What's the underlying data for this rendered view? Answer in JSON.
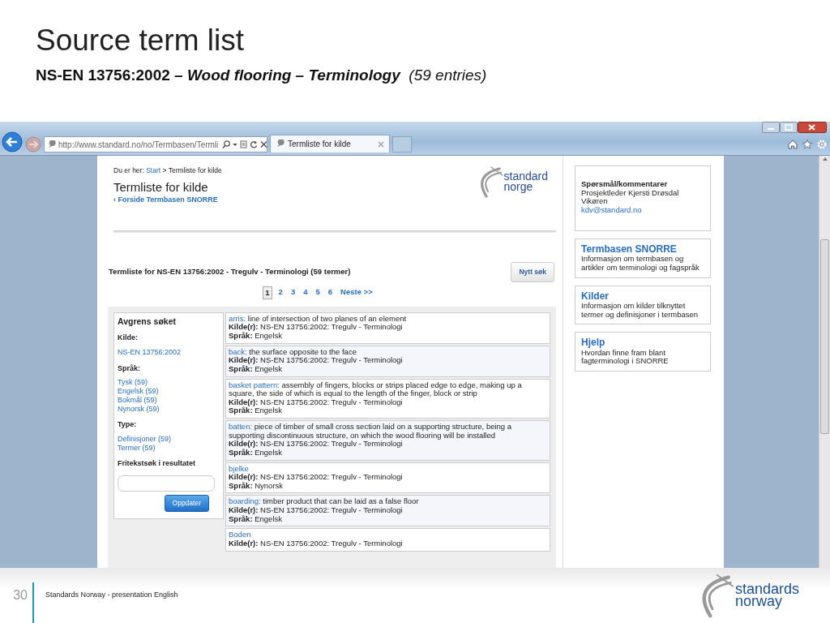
{
  "slide": {
    "title": "Source term list",
    "subtitle": {
      "code": "NS-EN 13756:2002 –",
      "name": "Wood flooring – Terminology",
      "count": "(59 entries)"
    }
  },
  "browser": {
    "address": "http://www.standard.no/no/Termbasen/Termli",
    "tabs": [
      {
        "label": "Termliste for kilde",
        "selected": true
      }
    ]
  },
  "page": {
    "breadcrumb": {
      "label": "Du er her:",
      "items": [
        "Start",
        "Termliste for kilde"
      ],
      "separator": ">"
    },
    "heading": "Termliste for kilde",
    "back_link": "‹ Forside Termbasen SNORRE",
    "logo": [
      "standard",
      "norge"
    ],
    "list_title": "Termliste for NS-EN 13756:2002 - Tregulv - Terminologi (59 termer)",
    "new_search_button": "Nytt søk",
    "pagination": [
      {
        "label": "1",
        "selected": true
      },
      {
        "label": "2",
        "selected": false
      },
      {
        "label": "3",
        "selected": false
      },
      {
        "label": "4",
        "selected": false
      },
      {
        "label": "5",
        "selected": false
      },
      {
        "label": "6",
        "selected": false
      },
      {
        "label": "Neste >>",
        "selected": false
      }
    ],
    "filter": {
      "title": "Avgrens søket",
      "sections": [
        {
          "heading": "Kilde:",
          "links": [
            "NS-EN 13756:2002"
          ]
        },
        {
          "heading": "Språk:",
          "links": [
            "Tysk (59)",
            "Engelsk (59)",
            "Bokmål (59)",
            "Nynorsk (59)"
          ]
        },
        {
          "heading": "Type:",
          "links": [
            "Definisjoner (59)",
            "Termer (59)"
          ]
        }
      ],
      "search_label": "Fritekstsøk i resultatet",
      "button": "Oppdater"
    },
    "entries": [
      {
        "term": "arris:",
        "definition": "line of intersection of two planes of an element",
        "source_label": "Kilde(r):",
        "source": "NS-EN 13756:2002: Tregulv - Terminologi",
        "language_label": "Språk:",
        "language": "Engelsk"
      },
      {
        "term": "back:",
        "definition": "the surface opposite to the face",
        "source_label": "Kilde(r):",
        "source": "NS-EN 13756:2002: Tregulv - Terminologi",
        "language_label": "Språk:",
        "language": "Engelsk"
      },
      {
        "term": "basket pattern:",
        "definition": "assembly of fingers, blocks or strips placed edge to edge, making up a square, the side of which is equal to the length of the finger, block or strip",
        "source_label": "Kilde(r):",
        "source": "NS-EN 13756:2002: Tregulv - Terminologi",
        "language_label": "Språk:",
        "language": "Engelsk"
      },
      {
        "term": "batten:",
        "definition": "piece of timber of small cross section laid on a supporting structure, being a supporting discontinuous structure, on which the wood flooring will be installed",
        "source_label": "Kilde(r):",
        "source": "NS-EN 13756:2002: Tregulv - Terminologi",
        "language_label": "Språk:",
        "language": "Engelsk"
      },
      {
        "term": "bjelke",
        "source_label": "Kilde(r):",
        "source": "NS-EN 13756:2002: Tregulv - Terminologi",
        "language_label": "Språk:",
        "language": "Nynorsk"
      },
      {
        "term": "boarding:",
        "definition": "timber product that can be laid as a false floor",
        "source_label": "Kilde(r):",
        "source": "NS-EN 13756:2002: Tregulv - Terminologi",
        "language_label": "Språk:",
        "language": "Engelsk"
      },
      {
        "term": "Boden",
        "source_label": "Kilde(r):",
        "source": "NS-EN 13756:2002: Tregulv - Terminologi"
      }
    ],
    "sidebar": [
      {
        "kind": "contact",
        "title": "Spørsmål/kommentarer",
        "text": "Prosjektleder Kjersti Drøsdal Vikøren",
        "link": "kdv@standard.no"
      },
      {
        "kind": "info",
        "title": "Termbasen SNORRE",
        "text": "Informasjon om termbasen og artikler om terminologi og fagspråk"
      },
      {
        "kind": "info",
        "title": "Kilder",
        "text": "Informasjon om kilder tilknyttet termer og definisjoner i termbasen"
      },
      {
        "kind": "info",
        "title": "Hjelp",
        "text": "Hvordan finne fram blant fagterminologi i SNORRE"
      }
    ]
  },
  "footer": {
    "page_number": "30",
    "text": "Standards Norway - presentation English",
    "logo": [
      "standards",
      "norway"
    ]
  }
}
